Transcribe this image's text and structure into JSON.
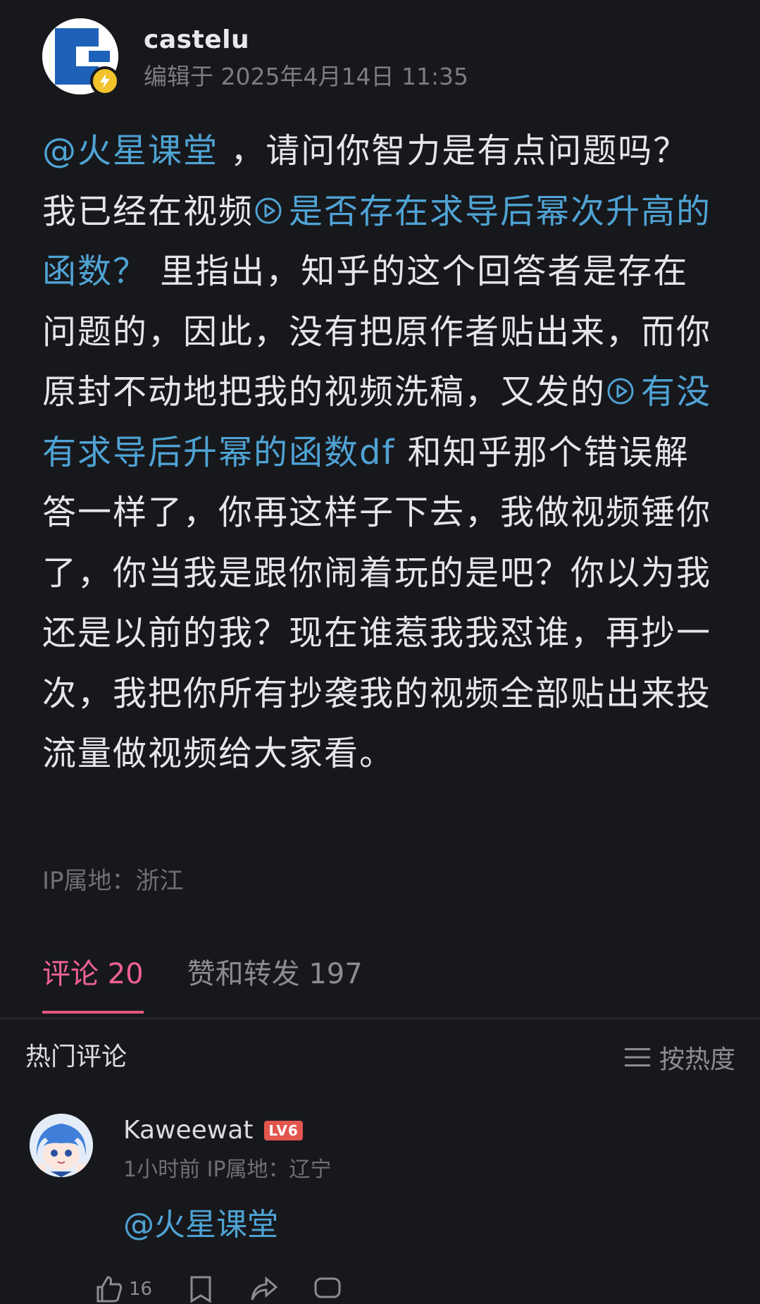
{
  "post": {
    "author": "castelu",
    "edited_time": "编辑于 2025年4月14日 11:35",
    "body": {
      "mention": "@火星课堂",
      "text1": " ，请问你智力是有点问题吗？我已经在视频",
      "link1": "是否存在求导后幂次升高的函数？",
      "text2": " 里指出，知乎的这个回答者是存在问题的，因此，没有把原作者贴出来，而你原封不动地把我的视频洗稿，又发的",
      "link2": "有没有求导后升幂的函数df",
      "text3": " 和知乎那个错误解答一样了，你再这样子下去，我做视频锤你了，你当我是跟你闹着玩的是吧？你以为我还是以前的我？现在谁惹我我怼谁，再抄一次，我把你所有抄袭我的视频全部贴出来投流量做视频给大家看。"
    },
    "ip_location": "IP属地：浙江"
  },
  "tabs": [
    {
      "label": "评论 20",
      "active": true
    },
    {
      "label": "赞和转发 197",
      "active": false
    }
  ],
  "hot_comments": {
    "title": "热门评论",
    "sort_label": "按热度"
  },
  "comment": {
    "username": "Kaweewat",
    "level": "LV6",
    "meta": "1小时前 IP属地：辽宁",
    "text": "@火星课堂",
    "like_count": "16"
  },
  "colors": {
    "background": "#17181c",
    "link": "#4fa3d4",
    "active_tab": "#f06292",
    "badge": "#e2564e"
  }
}
